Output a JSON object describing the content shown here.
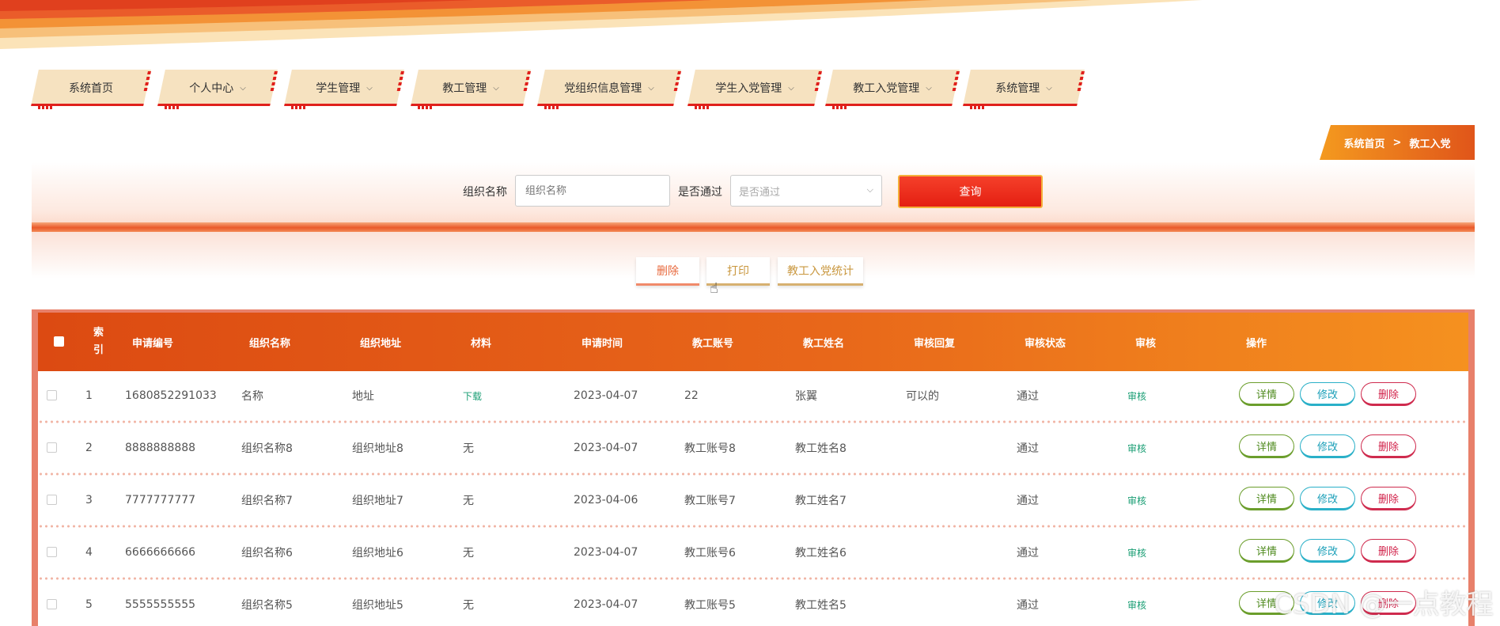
{
  "nav": {
    "items": [
      {
        "label": "系统首页",
        "has_dropdown": false
      },
      {
        "label": "个人中心",
        "has_dropdown": true
      },
      {
        "label": "学生管理",
        "has_dropdown": true
      },
      {
        "label": "教工管理",
        "has_dropdown": true
      },
      {
        "label": "党组织信息管理",
        "has_dropdown": true
      },
      {
        "label": "学生入党管理",
        "has_dropdown": true
      },
      {
        "label": "教工入党管理",
        "has_dropdown": true
      },
      {
        "label": "系统管理",
        "has_dropdown": true
      }
    ]
  },
  "breadcrumb": {
    "home": "系统首页",
    "separator": ">",
    "current": "教工入党"
  },
  "search": {
    "org_label": "组织名称",
    "org_placeholder": "组织名称",
    "passed_label": "是否通过",
    "passed_placeholder": "是否通过",
    "query_button": "查询"
  },
  "actions": {
    "delete": "删除",
    "print": "打印",
    "stats": "教工入党统计"
  },
  "table": {
    "headers": {
      "index": "索引",
      "app_no": "申请编号",
      "org_name": "组织名称",
      "org_addr": "组织地址",
      "material": "材料",
      "apply_time": "申请时间",
      "teacher_account": "教工账号",
      "teacher_name": "教工姓名",
      "reply": "审核回复",
      "status": "审核状态",
      "review": "审核",
      "ops": "操作"
    },
    "rows": [
      {
        "index": "1",
        "app_no": "1680852291033",
        "org_name": "名称",
        "org_addr": "地址",
        "material": "下载",
        "apply_time": "2023-04-07",
        "teacher_account": "22",
        "teacher_name": "张翼",
        "reply": "可以的",
        "status": "通过",
        "review": "审核"
      },
      {
        "index": "2",
        "app_no": "8888888888",
        "org_name": "组织名称8",
        "org_addr": "组织地址8",
        "material": "无",
        "apply_time": "2023-04-07",
        "teacher_account": "教工账号8",
        "teacher_name": "教工姓名8",
        "reply": "",
        "status": "通过",
        "review": "审核"
      },
      {
        "index": "3",
        "app_no": "7777777777",
        "org_name": "组织名称7",
        "org_addr": "组织地址7",
        "material": "无",
        "apply_time": "2023-04-06",
        "teacher_account": "教工账号7",
        "teacher_name": "教工姓名7",
        "reply": "",
        "status": "通过",
        "review": "审核"
      },
      {
        "index": "4",
        "app_no": "6666666666",
        "org_name": "组织名称6",
        "org_addr": "组织地址6",
        "material": "无",
        "apply_time": "2023-04-07",
        "teacher_account": "教工账号6",
        "teacher_name": "教工姓名6",
        "reply": "",
        "status": "通过",
        "review": "审核"
      },
      {
        "index": "5",
        "app_no": "5555555555",
        "org_name": "组织名称5",
        "org_addr": "组织地址5",
        "material": "无",
        "apply_time": "2023-04-07",
        "teacher_account": "教工账号5",
        "teacher_name": "教工姓名5",
        "reply": "",
        "status": "通过",
        "review": "审核"
      }
    ],
    "row_buttons": {
      "detail": "详情",
      "edit": "修改",
      "delete": "删除"
    }
  },
  "watermark": "CSDN @一点教程",
  "colors": {
    "accent_red": "#e41f12",
    "accent_orange": "#f5911f",
    "link_green": "#1a9e74"
  }
}
